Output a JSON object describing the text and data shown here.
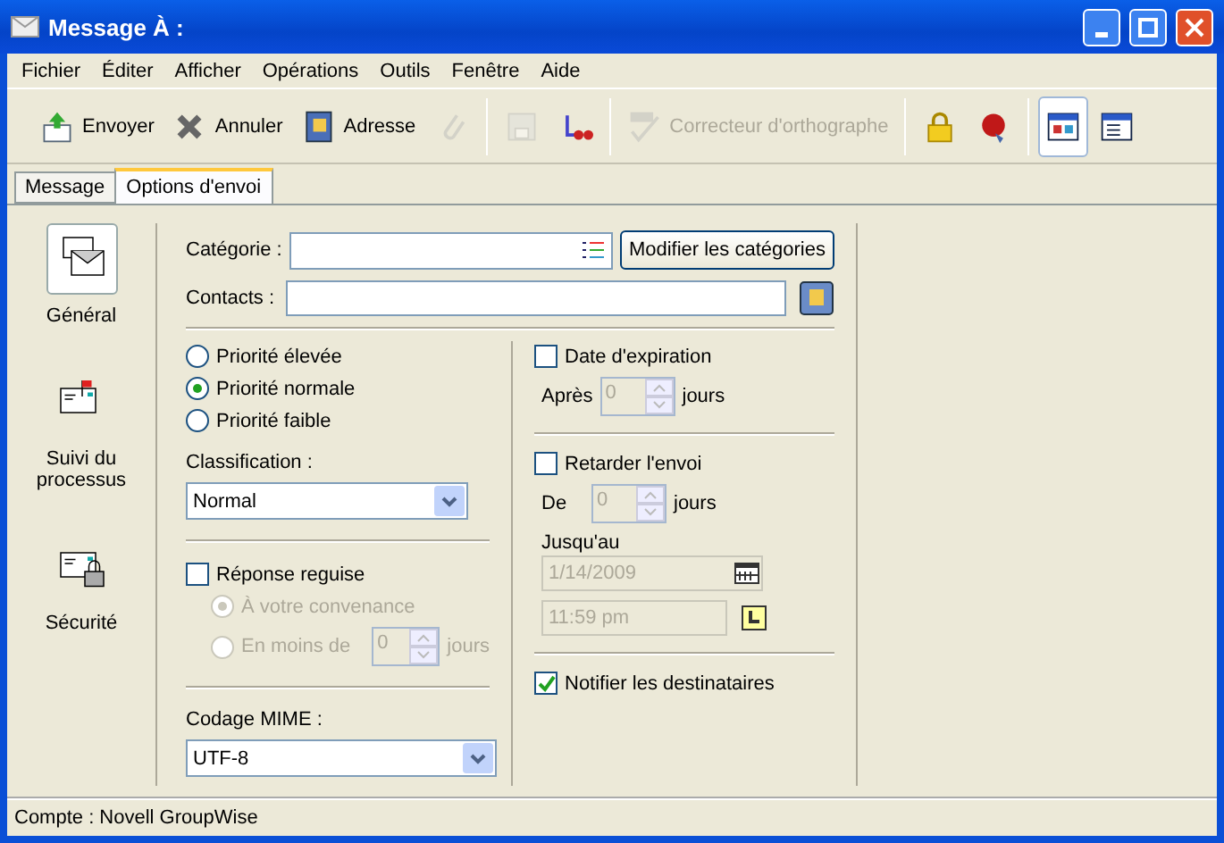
{
  "window": {
    "title": "Message À :"
  },
  "menu": [
    "Fichier",
    "Éditer",
    "Afficher",
    "Opérations",
    "Outils",
    "Fenêtre",
    "Aide"
  ],
  "toolbar": [
    {
      "kind": "button",
      "label": "Envoyer",
      "disabled": false,
      "selected": false
    },
    {
      "kind": "button",
      "label": "Annuler",
      "disabled": false,
      "selected": false
    },
    {
      "kind": "button",
      "label": "Adresse",
      "disabled": false,
      "selected": false
    },
    {
      "kind": "icon",
      "disabled": true,
      "selected": false
    },
    {
      "kind": "separator"
    },
    {
      "kind": "icon",
      "disabled": true,
      "selected": false
    },
    {
      "kind": "icon",
      "disabled": false,
      "selected": false
    },
    {
      "kind": "separator"
    },
    {
      "kind": "button",
      "label": "Correcteur d'orthographe",
      "disabled": true,
      "selected": false
    },
    {
      "kind": "separator"
    },
    {
      "kind": "icon",
      "disabled": false,
      "selected": false
    },
    {
      "kind": "icon",
      "disabled": false,
      "selected": false
    },
    {
      "kind": "separator"
    },
    {
      "kind": "icon",
      "disabled": false,
      "selected": true
    },
    {
      "kind": "icon",
      "disabled": false,
      "selected": false
    }
  ],
  "tabs": [
    {
      "label": "Message",
      "selected": false
    },
    {
      "label": "Options d'envoi",
      "selected": true
    }
  ],
  "sidebar": {
    "items": [
      {
        "label": "Général",
        "selected": true
      },
      {
        "label": "Suivi du processus",
        "selected": false
      },
      {
        "label": "Sécurité",
        "selected": false
      }
    ]
  },
  "form": {
    "category": {
      "label": "Catégorie :",
      "button": "Modifier les catégories"
    },
    "contacts": {
      "label": "Contacts :"
    },
    "priority": [
      {
        "label": "Priorité élevée",
        "selected": false
      },
      {
        "label": "Priorité normale",
        "selected": true
      },
      {
        "label": "Priorité faible",
        "selected": false
      }
    ],
    "classification": {
      "label": "Classification :",
      "value": "Normal"
    },
    "reply": {
      "label": "Réponse reguise",
      "checked": false,
      "options": [
        {
          "label": "À votre convenance",
          "selected": true,
          "disabled": true
        },
        {
          "label": "En moins de",
          "selected": false,
          "disabled": true,
          "value": "0",
          "unit": "jours"
        }
      ]
    },
    "mime": {
      "label": "Codage MIME :",
      "value": "UTF-8"
    },
    "expiration": {
      "label": "Date d'expiration",
      "checked": false,
      "after_label": "Après",
      "value": "0",
      "unit": "jours",
      "disabled": true
    },
    "delay": {
      "label": "Retarder l'envoi",
      "checked": false,
      "from_label": "De",
      "value": "0",
      "unit": "jours",
      "disabled": true,
      "until_label": "Jusqu'au",
      "date": "1/14/2009",
      "time": "11:59 pm"
    },
    "notify": {
      "label": "Notifier les destinataires",
      "checked": true
    }
  },
  "status_bar": "Compte : Novell GroupWise"
}
